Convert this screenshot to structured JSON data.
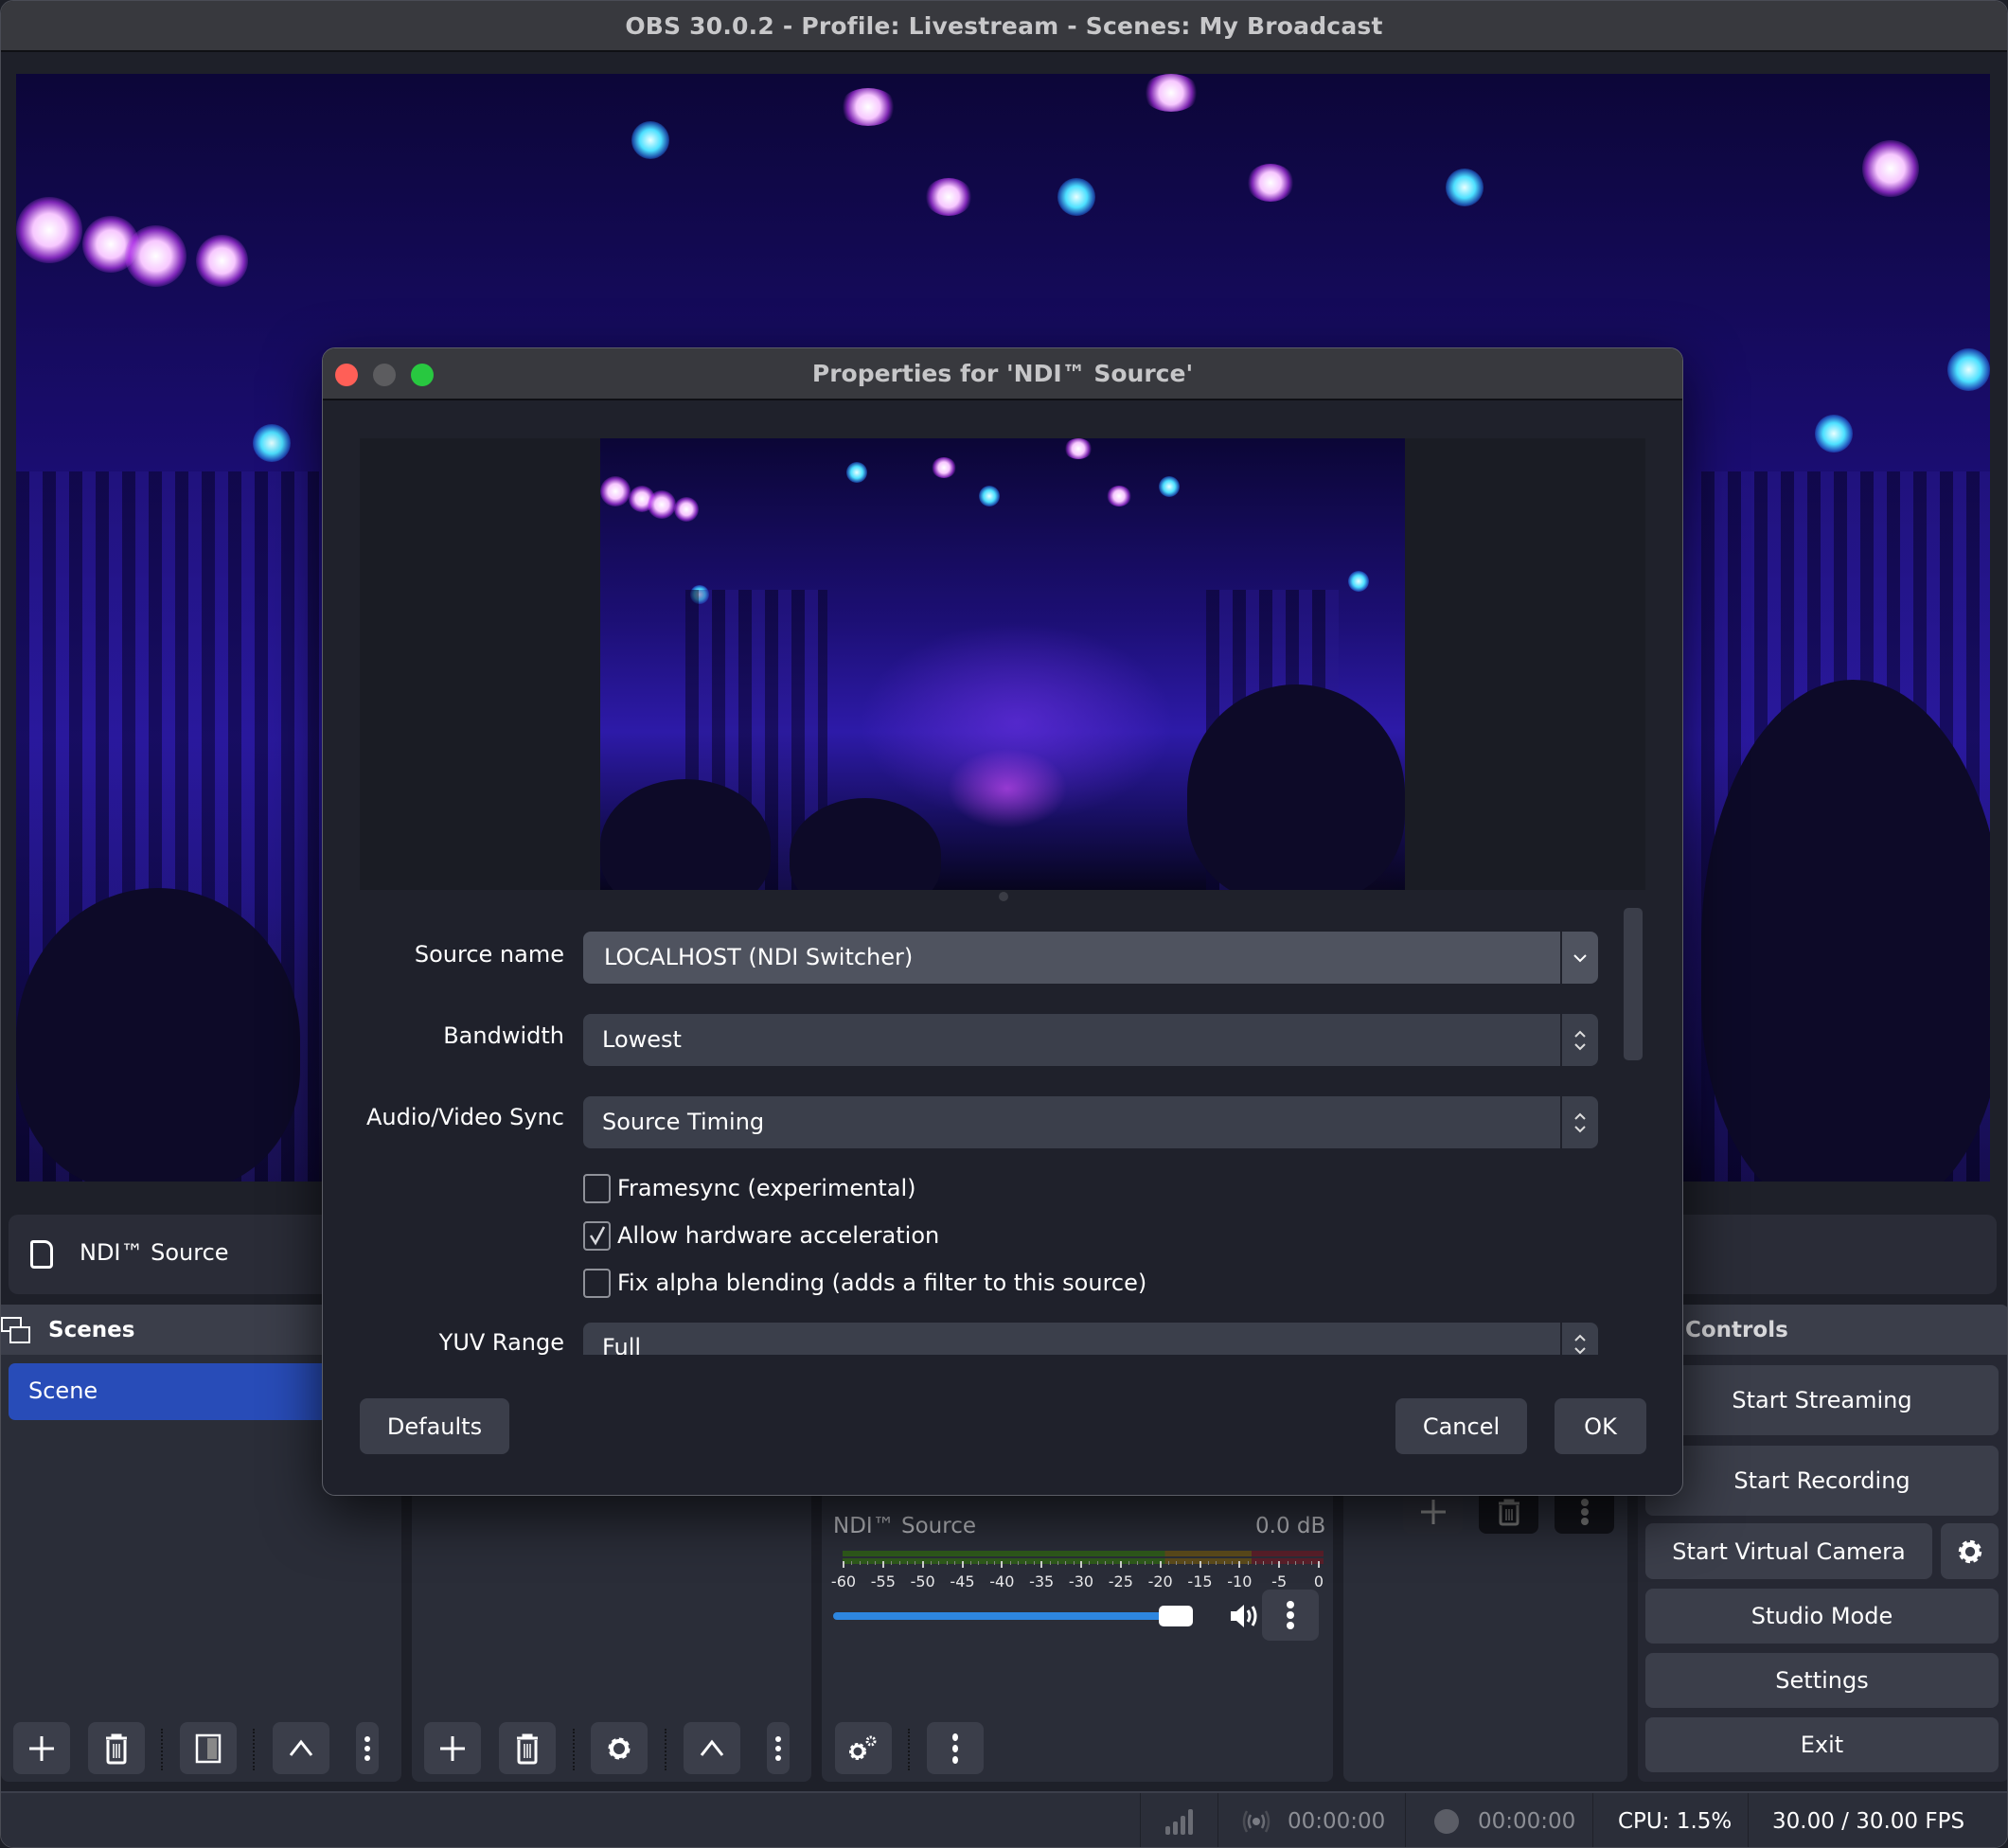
{
  "window": {
    "title": "OBS 30.0.2 - Profile: Livestream - Scenes: My Broadcast"
  },
  "source_toolbar": {
    "selected_source": "NDI™ Source",
    "icon": "file-icon"
  },
  "scenes_dock": {
    "title": "Scenes",
    "icon": "scenes-icon",
    "items": [
      {
        "label": "Scene",
        "selected": true
      }
    ]
  },
  "audio_mixer": {
    "channels": [
      {
        "name": "NDI™ Source",
        "level": "0.0 dB",
        "volume_fraction": 0.92,
        "muted": false,
        "scale_labels": [
          "-60",
          "-55",
          "-50",
          "-45",
          "-40",
          "-35",
          "-30",
          "-25",
          "-20",
          "-15",
          "-10",
          "-5",
          "0"
        ]
      }
    ],
    "meter_colors": {
      "green": "#2f5a1b",
      "yellow": "#5c4b1b",
      "red": "#5a1f2a"
    },
    "slider_color": "#2d86e0"
  },
  "controls_dock": {
    "title": "Controls",
    "buttons": {
      "start_streaming": "Start Streaming",
      "start_recording": "Start Recording",
      "start_virtual_camera": "Start Virtual Camera",
      "studio_mode": "Studio Mode",
      "settings": "Settings",
      "exit": "Exit"
    }
  },
  "status_bar": {
    "stream_time": "00:00:00",
    "record_time": "00:00:00",
    "cpu": "CPU: 1.5%",
    "fps": "30.00 / 30.00 FPS"
  },
  "dialog": {
    "title": "Properties for 'NDI™ Source'",
    "fields": {
      "source_name": {
        "label": "Source name",
        "value": "LOCALHOST (NDI Switcher)"
      },
      "bandwidth": {
        "label": "Bandwidth",
        "value": "Lowest"
      },
      "av_sync": {
        "label": "Audio/Video Sync",
        "value": "Source Timing"
      },
      "yuv_range": {
        "label": "YUV Range",
        "value": "Full"
      }
    },
    "checkboxes": [
      {
        "label": "Framesync (experimental)",
        "checked": false
      },
      {
        "label": "Allow hardware acceleration",
        "checked": true
      },
      {
        "label": "Fix alpha blending (adds a filter to this source)",
        "checked": false
      }
    ],
    "buttons": {
      "defaults": "Defaults",
      "cancel": "Cancel",
      "ok": "OK"
    },
    "traffic_lights": {
      "close": "#ff5f57",
      "minimize": "#5c5c5f",
      "zoom": "#28c840"
    }
  },
  "colors": {
    "accent_selection": "#284cb8",
    "window_bg": "#1e2029",
    "button_bg": "#3b3e4a"
  }
}
